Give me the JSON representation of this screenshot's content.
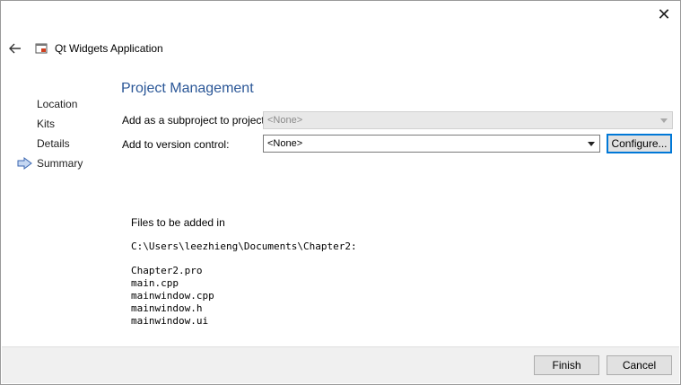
{
  "window": {
    "close_glyph": "✕",
    "title": "Qt Widgets Application"
  },
  "sidebar": {
    "items": [
      {
        "label": "Location"
      },
      {
        "label": "Kits"
      },
      {
        "label": "Details"
      },
      {
        "label": "Summary",
        "current": true
      }
    ]
  },
  "page": {
    "title": "Project Management",
    "subproject_label": "Add as a subproject to project:",
    "subproject_value": "<None>",
    "vcs_label": "Add to version control:",
    "vcs_value": "<None>",
    "configure_label": "Configure..."
  },
  "summary": {
    "lead": "Files to be added in",
    "path": "C:\\Users\\leezhieng\\Documents\\Chapter2:",
    "files": [
      "Chapter2.pro",
      "main.cpp",
      "mainwindow.cpp",
      "mainwindow.h",
      "mainwindow.ui"
    ]
  },
  "footer": {
    "finish_label": "Finish",
    "cancel_label": "Cancel"
  },
  "colors": {
    "accent": "#2b5797",
    "focus": "#0078d7"
  }
}
